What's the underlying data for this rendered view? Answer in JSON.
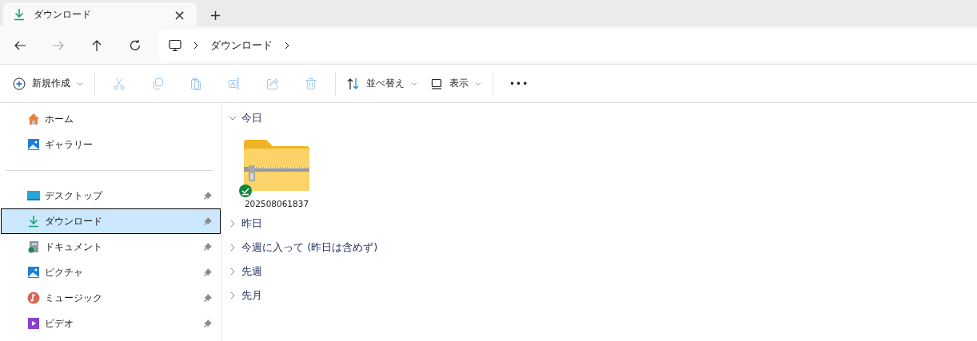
{
  "tab": {
    "title": "ダウンロード",
    "close": "×",
    "new_tab": "+"
  },
  "nav": {
    "breadcrumb": [
      {
        "label": "ダウンロード"
      }
    ]
  },
  "toolbar": {
    "new_label": "新規作成",
    "actions": [
      {
        "kind": "cut",
        "disabled": true
      },
      {
        "kind": "copy",
        "disabled": true
      },
      {
        "kind": "paste",
        "disabled": true
      },
      {
        "kind": "rename",
        "disabled": true
      },
      {
        "kind": "share",
        "disabled": true
      },
      {
        "kind": "delete",
        "disabled": true
      }
    ],
    "sort_label": "並べ替え",
    "view_label": "表示",
    "more": "•••"
  },
  "sidebar": {
    "top": [
      {
        "kind": "home",
        "label": "ホーム",
        "selected": false
      },
      {
        "kind": "gallery",
        "label": "ギャラリー",
        "selected": false
      }
    ],
    "pinned": [
      {
        "kind": "desktop",
        "label": "デスクトップ",
        "selected": false
      },
      {
        "kind": "download",
        "label": "ダウンロード",
        "selected": true
      },
      {
        "kind": "documents",
        "label": "ドキュメント",
        "selected": false
      },
      {
        "kind": "pictures",
        "label": "ピクチャ",
        "selected": false
      },
      {
        "kind": "music",
        "label": "ミュージック",
        "selected": false
      },
      {
        "kind": "videos",
        "label": "ビデオ",
        "selected": false
      }
    ]
  },
  "groups": [
    {
      "label": "今日",
      "expanded": true,
      "files": [
        {
          "name": "202508061837",
          "synced": true
        }
      ]
    },
    {
      "label": "昨日",
      "expanded": false
    },
    {
      "label": "今週に入って (昨日は含めず)",
      "expanded": false
    },
    {
      "label": "先週",
      "expanded": false
    },
    {
      "label": "先月",
      "expanded": false
    }
  ]
}
